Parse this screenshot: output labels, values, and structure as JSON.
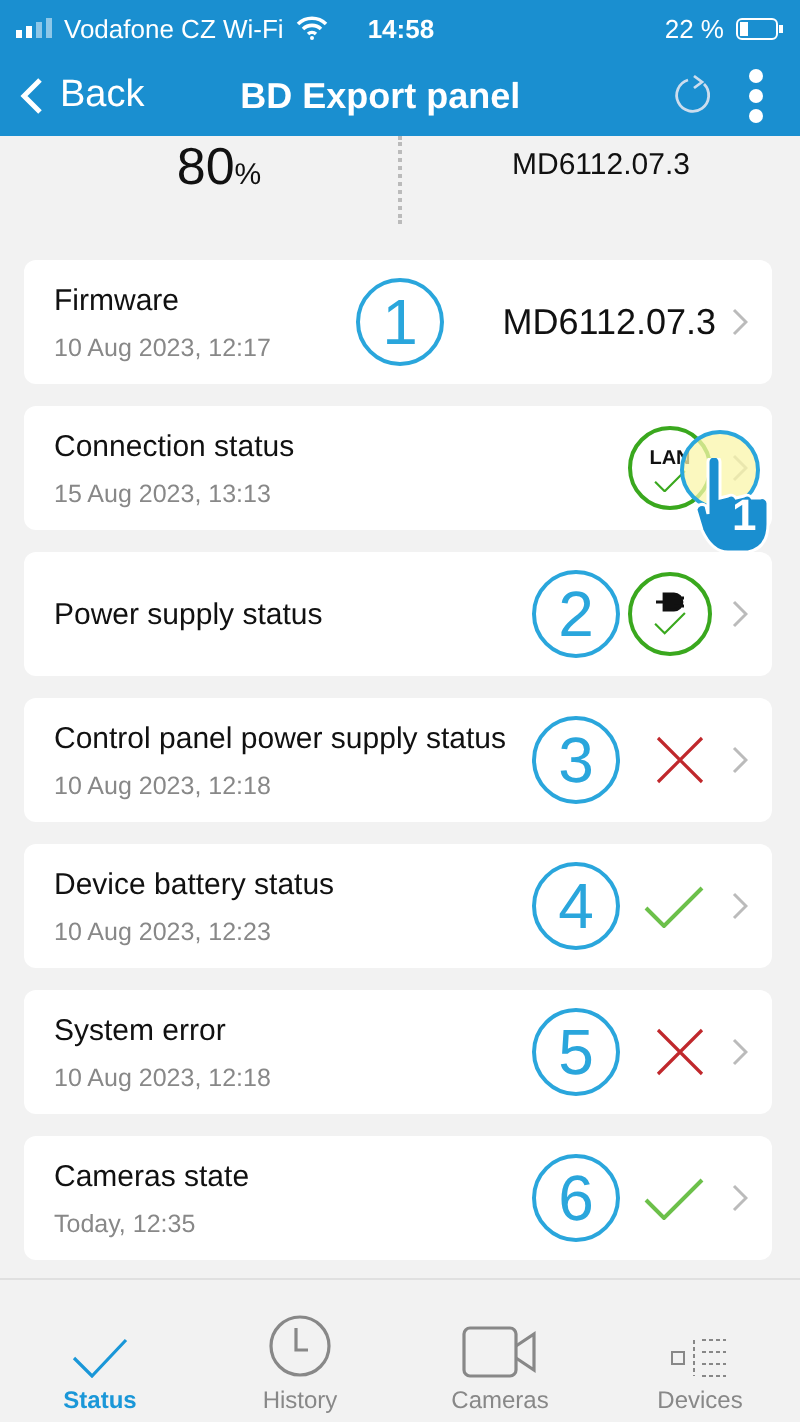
{
  "status_bar": {
    "carrier": "Vodafone CZ Wi-Fi",
    "time": "14:58",
    "battery": "22 %"
  },
  "nav": {
    "back": "Back",
    "title": "BD Export panel"
  },
  "summary": {
    "value": "80",
    "unit": "%",
    "firmware": "MD6112.07.3"
  },
  "rows": [
    {
      "title": "Firmware",
      "date": "10 Aug 2023, 12:17",
      "callout": "1",
      "kind": "text",
      "value": "MD6112.07.3"
    },
    {
      "title": "Connection status",
      "date": "15 Aug 2023, 13:13",
      "kind": "lan",
      "ok": true,
      "label": "LAN",
      "pointer": "1"
    },
    {
      "title": "Power supply status",
      "callout": "2",
      "kind": "plug",
      "ok": true
    },
    {
      "title": "Control panel power supply status",
      "date": "10 Aug 2023, 12:18",
      "callout": "3",
      "kind": "plain",
      "ok": false
    },
    {
      "title": "Device battery status",
      "date": "10 Aug 2023, 12:23",
      "callout": "4",
      "kind": "plain",
      "ok": true
    },
    {
      "title": "System error",
      "date": "10 Aug 2023, 12:18",
      "callout": "5",
      "kind": "plain",
      "ok": false
    },
    {
      "title": "Cameras state",
      "date": "Today, 12:35",
      "callout": "6",
      "kind": "plain",
      "ok": true
    }
  ],
  "tabs": [
    {
      "label": "Status",
      "kind": "check",
      "selected": true
    },
    {
      "label": "History",
      "kind": "clock",
      "selected": false
    },
    {
      "label": "Cameras",
      "kind": "camera",
      "selected": false
    },
    {
      "label": "Devices",
      "kind": "list",
      "selected": false
    }
  ]
}
